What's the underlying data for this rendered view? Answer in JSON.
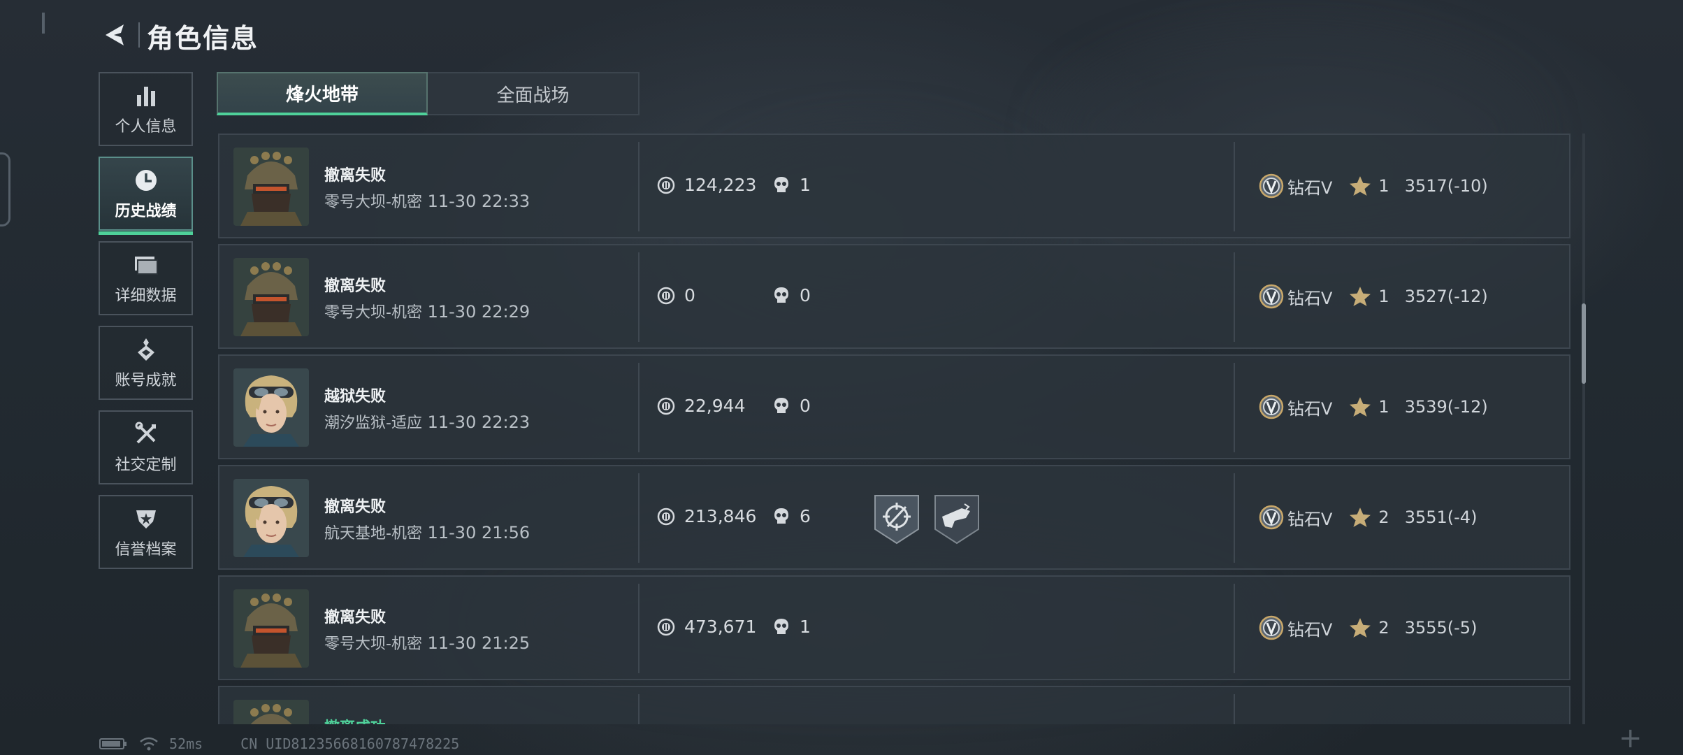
{
  "header": {
    "title": "角色信息"
  },
  "nav": [
    {
      "label": "个人信息",
      "icon": "bar-chart-icon",
      "active": false
    },
    {
      "label": "历史战绩",
      "icon": "clock-icon",
      "active": true
    },
    {
      "label": "详细数据",
      "icon": "folder-icon",
      "active": false
    },
    {
      "label": "账号成就",
      "icon": "achievement-icon",
      "active": false
    },
    {
      "label": "社交定制",
      "icon": "tools-icon",
      "active": false
    },
    {
      "label": "信誉档案",
      "icon": "shield-star-icon",
      "active": false
    }
  ],
  "tabs": [
    {
      "label": "烽火地带",
      "active": true
    },
    {
      "label": "全面战场",
      "active": false
    }
  ],
  "records": [
    {
      "result": "撤离失败",
      "map": "零号大坝-机密",
      "time": "11-30 22:33",
      "value": "124,223",
      "kills": "1",
      "rank": "钻石V",
      "stars": "1",
      "score": "3517(-10)",
      "avatar": "soldier"
    },
    {
      "result": "撤离失败",
      "map": "零号大坝-机密",
      "time": "11-30 22:29",
      "value": "0",
      "kills": "0",
      "rank": "钻石V",
      "stars": "1",
      "score": "3527(-12)",
      "avatar": "soldier"
    },
    {
      "result": "越狱失败",
      "map": "潮汐监狱-适应",
      "time": "11-30 22:23",
      "value": "22,944",
      "kills": "0",
      "rank": "钻石V",
      "stars": "1",
      "score": "3539(-12)",
      "avatar": "woman"
    },
    {
      "result": "撤离失败",
      "map": "航天基地-机密",
      "time": "11-30 21:56",
      "value": "213,846",
      "kills": "6",
      "rank": "钻石V",
      "stars": "2",
      "score": "3551(-4)",
      "avatar": "woman",
      "badges": [
        "crosshair-badge-icon",
        "gun-badge-icon"
      ]
    },
    {
      "result": "撤离失败",
      "map": "零号大坝-机密",
      "time": "11-30 21:25",
      "value": "473,671",
      "kills": "1",
      "rank": "钻石V",
      "stars": "2",
      "score": "3555(-5)",
      "avatar": "soldier"
    },
    {
      "result": "撤离成功",
      "map": "",
      "time": "",
      "value": "",
      "kills": "",
      "rank": "",
      "stars": "",
      "score": "",
      "avatar": "soldier",
      "partial": true
    }
  ],
  "status_bar": {
    "ping": "52ms",
    "uid": "CN UID8123566816078747822​5"
  },
  "colors": {
    "accent": "#4fd19a",
    "panel": "#2c343c",
    "border": "#3d464f"
  }
}
